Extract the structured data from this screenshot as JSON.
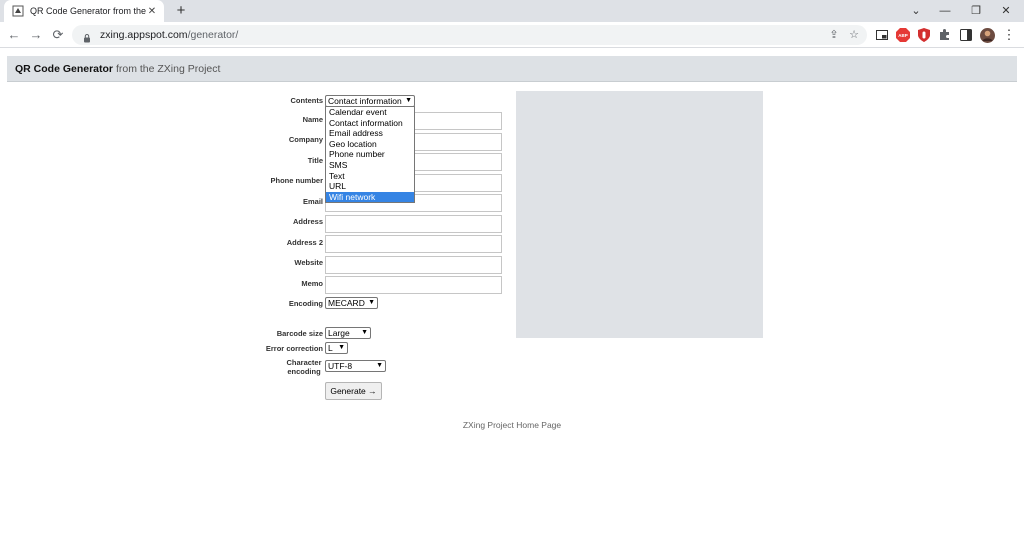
{
  "browser": {
    "tab_title": "QR Code Generator from the ZXi",
    "url_host": "zxing.appspot.com",
    "url_path": "/generator/",
    "new_tab": "+",
    "back": "←",
    "forward": "→",
    "reload": "⟳",
    "close_tab": "✕",
    "minimize": "—",
    "restore": "❐",
    "close_window": "✕",
    "menu": "⋮",
    "adblock": "ABP"
  },
  "page": {
    "title_strong": "QR Code Generator",
    "title_rest": " from the ZXing Project"
  },
  "form": {
    "labels": {
      "contents": "Contents",
      "name": "Name",
      "company": "Company",
      "title": "Title",
      "phone": "Phone number",
      "email": "Email",
      "address": "Address",
      "address2": "Address 2",
      "website": "Website",
      "memo": "Memo",
      "encoding": "Encoding",
      "barcode_size": "Barcode size",
      "error_correction": "Error correction",
      "character_encoding": "Character encoding"
    },
    "contents_value": "Contact information",
    "contents_options": [
      "Calendar event",
      "Contact information",
      "Email address",
      "Geo location",
      "Phone number",
      "SMS",
      "Text",
      "URL",
      "Wifi network"
    ],
    "highlighted_option": "Wifi network",
    "encoding_value": "MECARD",
    "barcode_size_value": "Large",
    "error_correction_value": "L",
    "character_encoding_value": "UTF-8",
    "generate_label": "Generate →"
  },
  "footer": {
    "link": "ZXing Project Home Page"
  },
  "colors": {
    "header_bg": "#dde1e5",
    "qr_placeholder": "#dfe2e6",
    "highlight": "#3584e4"
  }
}
